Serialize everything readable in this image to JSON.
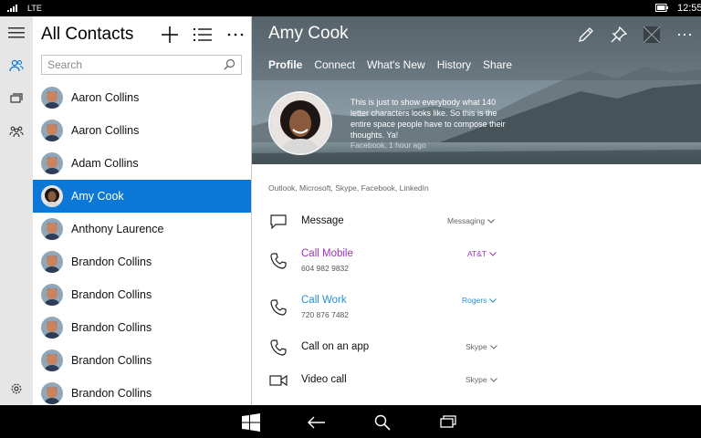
{
  "status": {
    "network": "LTE",
    "time": "12:55"
  },
  "rail": {
    "items": [
      {
        "icon": "people-icon"
      },
      {
        "icon": "chat-icon"
      },
      {
        "icon": "groups-icon"
      },
      {
        "icon": "gear-icon"
      }
    ]
  },
  "list": {
    "title": "All Contacts",
    "search_placeholder": "Search",
    "contacts": [
      {
        "name": "Aaron Collins"
      },
      {
        "name": "Aaron Collins"
      },
      {
        "name": "Adam Collins"
      },
      {
        "name": "Amy Cook"
      },
      {
        "name": "Anthony Laurence"
      },
      {
        "name": "Brandon Collins"
      },
      {
        "name": "Brandon Collins"
      },
      {
        "name": "Brandon Collins"
      },
      {
        "name": "Brandon Collins"
      },
      {
        "name": "Brandon Collins"
      }
    ],
    "selected_index": 3
  },
  "detail": {
    "name": "Amy Cook",
    "tabs": [
      "Profile",
      "Connect",
      "What's New",
      "History",
      "Share"
    ],
    "post": "This is just to show everybody what 140 letter characters looks like. So this is the entire space people have to compose their thoughts. Ya!",
    "post_meta": "Facebook, 1 hour ago",
    "sources": "Outlook, Microsoft, Skype, Facebook, LinkedIn",
    "actions": [
      {
        "label": "Message",
        "sub": "",
        "provider": "Messaging"
      },
      {
        "label": "Call Mobile",
        "sub": "604 982 9832",
        "provider": "AT&T"
      },
      {
        "label": "Call Work",
        "sub": "720 876 7482",
        "provider": "Rogers"
      },
      {
        "label": "Call on an app",
        "sub": "",
        "provider": "Skype"
      },
      {
        "label": "Video call",
        "sub": "",
        "provider": "Skype"
      }
    ]
  },
  "colors": {
    "accent": "#0b78d7",
    "mobile": "#a032b8",
    "work": "#1f8fd6"
  }
}
